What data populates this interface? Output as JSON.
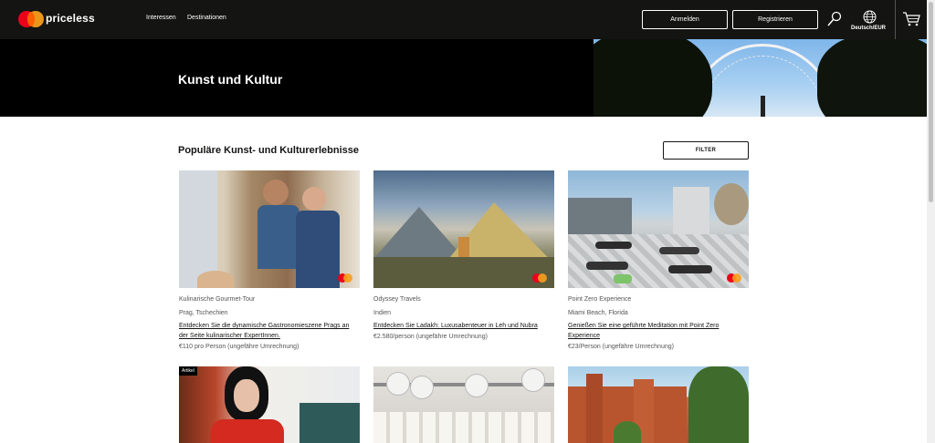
{
  "header": {
    "brand": "priceless",
    "nav": [
      "Interessen",
      "Destinationen"
    ],
    "login_label": "Anmelden",
    "register_label": "Registrieren",
    "lang_currency": "Deutsch/EUR",
    "icons": [
      "mastercard-logo",
      "search-icon",
      "globe-icon",
      "cart-icon"
    ]
  },
  "hero": {
    "title": "Kunst und Kultur"
  },
  "section": {
    "title": "Populäre Kunst- und Kulturerlebnisse",
    "filter_label": "FILTER"
  },
  "cards": [
    {
      "partner": "Kulinarische Gourmet-Tour",
      "location": "Prag, Tschechien",
      "description": "Entdecken Sie die dynamische Gastronomieszene Prags an der Seite kulinarischer ExpertInnen.",
      "price": "€110 pro Person (ungefähre Umrechnung)"
    },
    {
      "partner": "Odyssey Travels",
      "location": "Indien",
      "description": "Entdecken Sie Ladakh: Luxusabenteuer in Leh und Nubra",
      "price": "€2.580/person (ungefähre Umrechnung)"
    },
    {
      "partner": "Point Zero Experience",
      "location": "Miami Beach, Florida",
      "description": "Genießen Sie eine geführte Meditation mit Point Zero Experience",
      "price": "€23/Person (ungefähre Umrechnung)"
    }
  ],
  "row2": {
    "tag": "Artikel"
  },
  "colors": {
    "nav_bg": "#141413",
    "mc_red": "#eb001b",
    "mc_yellow": "#f79e1b"
  }
}
